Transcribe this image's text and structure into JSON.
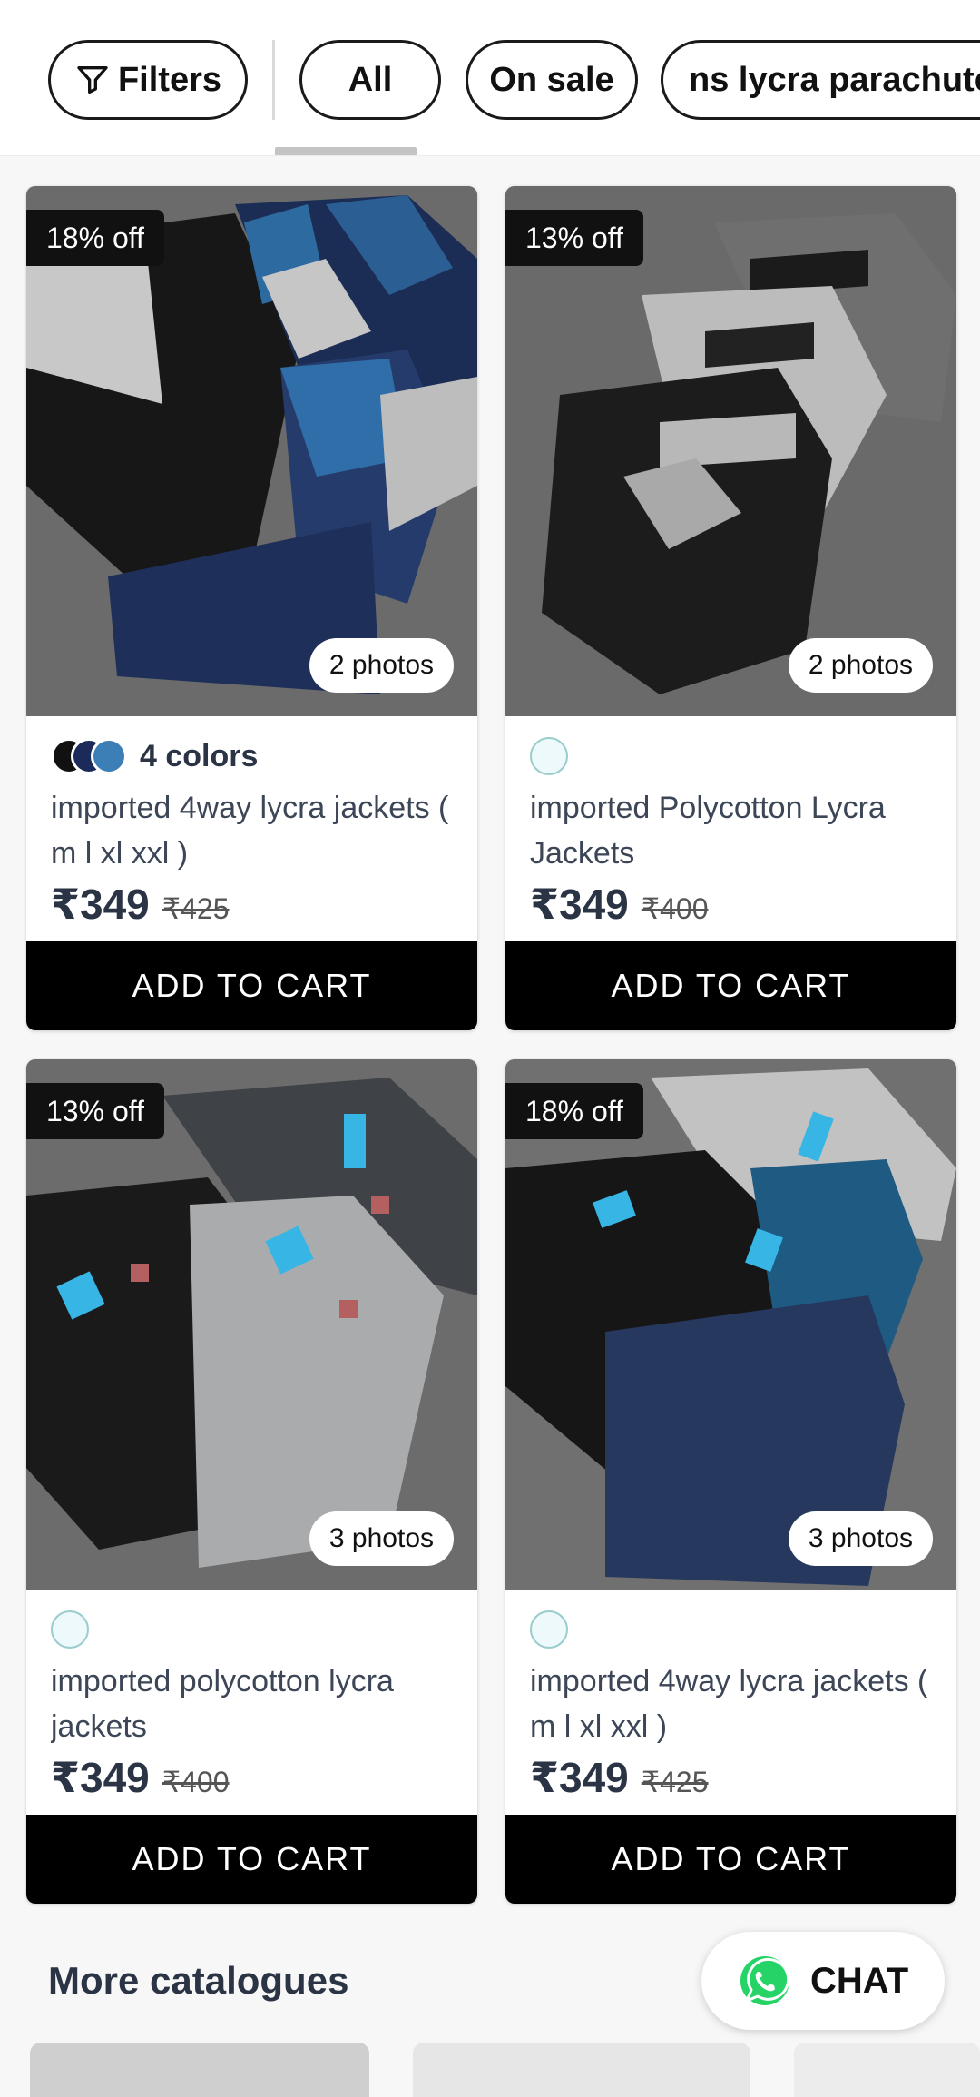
{
  "filters": {
    "filters_label": "Filters",
    "chips": [
      "All",
      "On sale",
      "ns lycra parachute"
    ]
  },
  "products": [
    {
      "discount": "18% off",
      "photos": "2 photos",
      "colors_label": "4 colors",
      "colors": [
        "#111111",
        "#1c2a5a",
        "#3b7fb6"
      ],
      "title": "imported 4way lycra jackets ( m l xl xxl )",
      "price": "₹349",
      "mrp": "₹425",
      "cta": "ADD TO CART"
    },
    {
      "discount": "13% off",
      "photos": "2 photos",
      "colors_label": "",
      "title": "imported Polycotton Lycra Jackets",
      "price": "₹349",
      "mrp": "₹400",
      "cta": "ADD TO CART"
    },
    {
      "discount": "13% off",
      "photos": "3 photos",
      "colors_label": "",
      "title": "imported polycotton lycra jackets",
      "price": "₹349",
      "mrp": "₹400",
      "cta": "ADD TO CART"
    },
    {
      "discount": "18% off",
      "photos": "3 photos",
      "colors_label": "",
      "title": "imported 4way lycra jackets ( m l xl xxl )",
      "price": "₹349",
      "mrp": "₹425",
      "cta": "ADD TO CART"
    }
  ],
  "more_catalogues": "More catalogues",
  "chat": {
    "label": "CHAT",
    "icon": "whatsapp-icon",
    "color": "#25d366"
  }
}
